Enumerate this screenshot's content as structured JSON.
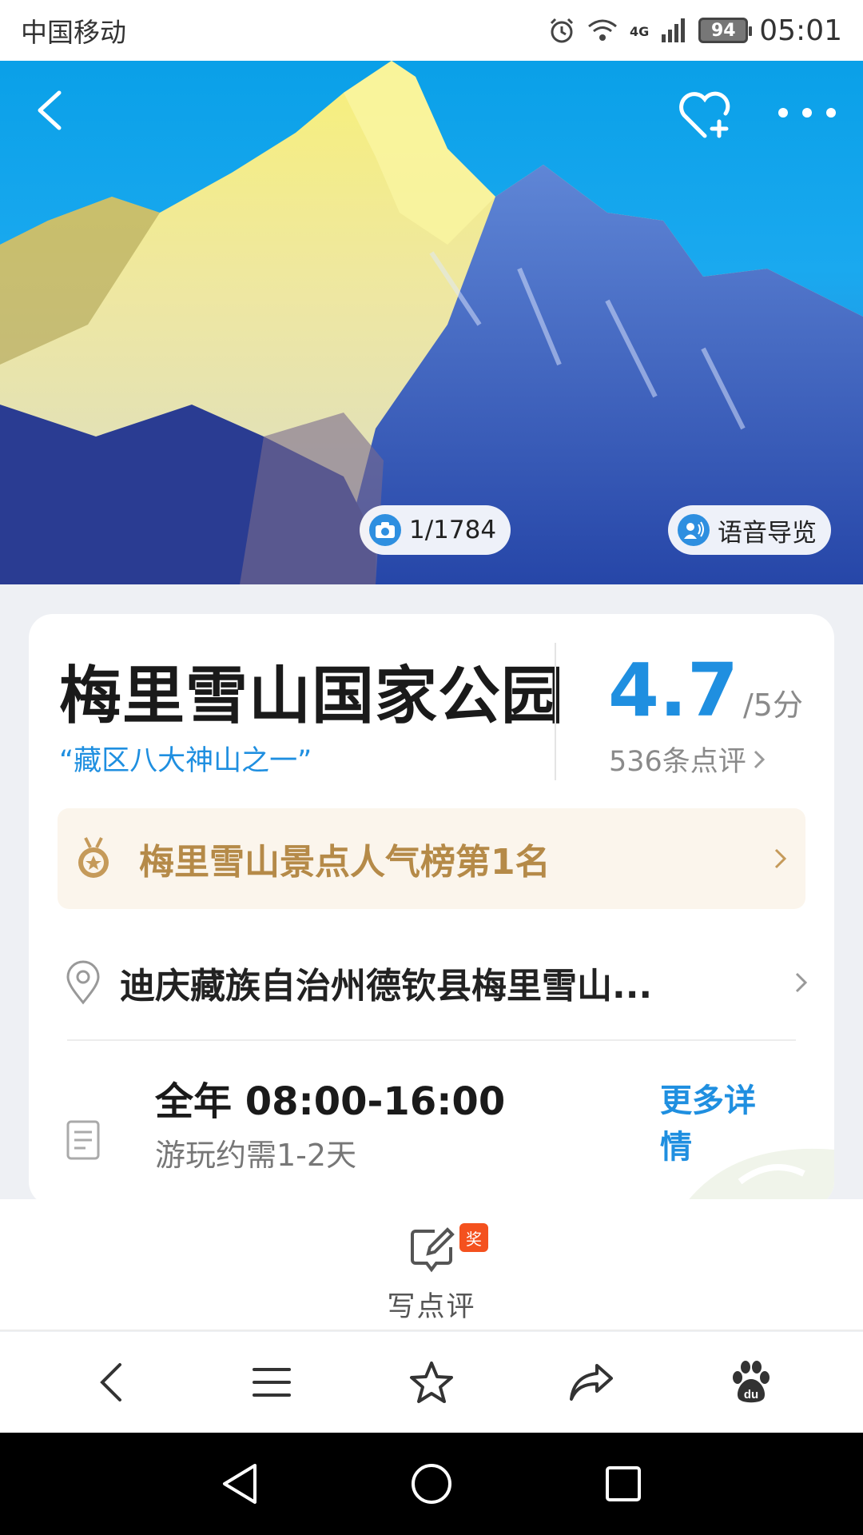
{
  "status_bar": {
    "carrier": "中国移动",
    "network": "4G",
    "battery": "94",
    "time": "05:01",
    "icons": [
      "alarm-icon",
      "wifi-icon",
      "signal-icon",
      "battery-icon"
    ]
  },
  "hero": {
    "photo_counter": "1/1784",
    "audio_guide_label": "语音导览",
    "icons": [
      "back-icon",
      "favorite-add-icon",
      "more-icon",
      "camera-icon",
      "audio-guide-icon"
    ]
  },
  "attraction": {
    "name": "梅里雪山国家公园",
    "tagline": "“藏区八大神山之一”",
    "rating": "4.7",
    "rating_scale": "/5分",
    "review_count": "536条点评"
  },
  "ranking": {
    "label": "梅里雪山景点人气榜第1名",
    "icon": "medal-icon"
  },
  "address": {
    "text": "迪庆藏族自治州德钦县梅里雪山...",
    "icon": "location-pin-icon"
  },
  "hours": {
    "main": "全年 08:00-16:00",
    "duration": "游玩约需1-2天",
    "more_label": "更多详情",
    "icon": "document-icon"
  },
  "review_action": {
    "label": "写点评",
    "badge": "奖",
    "icon": "edit-icon"
  },
  "browser_toolbar": [
    "back-icon",
    "menu-icon",
    "star-icon",
    "share-icon",
    "baidu-paw-icon"
  ],
  "system_nav": [
    "back-triangle-icon",
    "home-circle-icon",
    "recents-square-icon"
  ],
  "colors": {
    "accent": "#1f8fe0",
    "rank_text": "#b58a48",
    "rank_bg": "#fbf5ec",
    "badge": "#f4511e"
  }
}
